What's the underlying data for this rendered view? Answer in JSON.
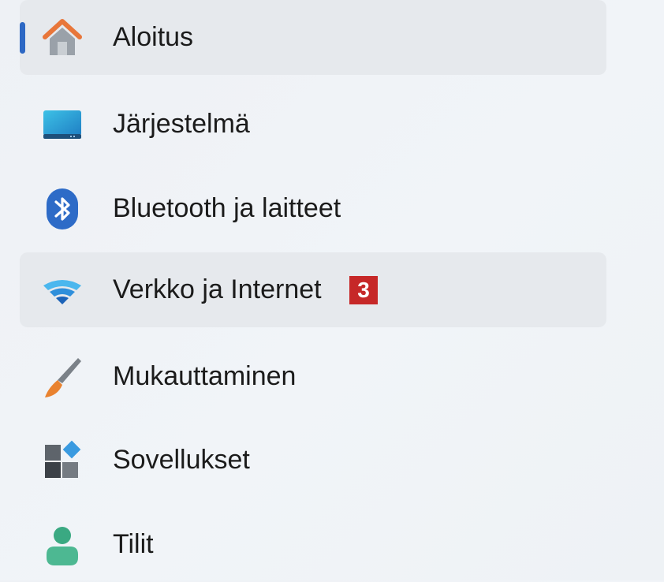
{
  "nav": {
    "items": [
      {
        "label": "Aloitus",
        "icon": "home-icon",
        "selected": true
      },
      {
        "label": "Järjestelmä",
        "icon": "system-icon"
      },
      {
        "label": "Bluetooth ja laitteet",
        "icon": "bluetooth-icon"
      },
      {
        "label": "Verkko ja Internet",
        "icon": "wifi-icon",
        "badge": "3"
      },
      {
        "label": "Mukauttaminen",
        "icon": "paintbrush-icon"
      },
      {
        "label": "Sovellukset",
        "icon": "apps-icon"
      },
      {
        "label": "Tilit",
        "icon": "account-icon"
      }
    ]
  },
  "colors": {
    "accent": "#2d68c4",
    "selected_bg": "#e6e9ed",
    "badge_bg": "#c62828"
  }
}
